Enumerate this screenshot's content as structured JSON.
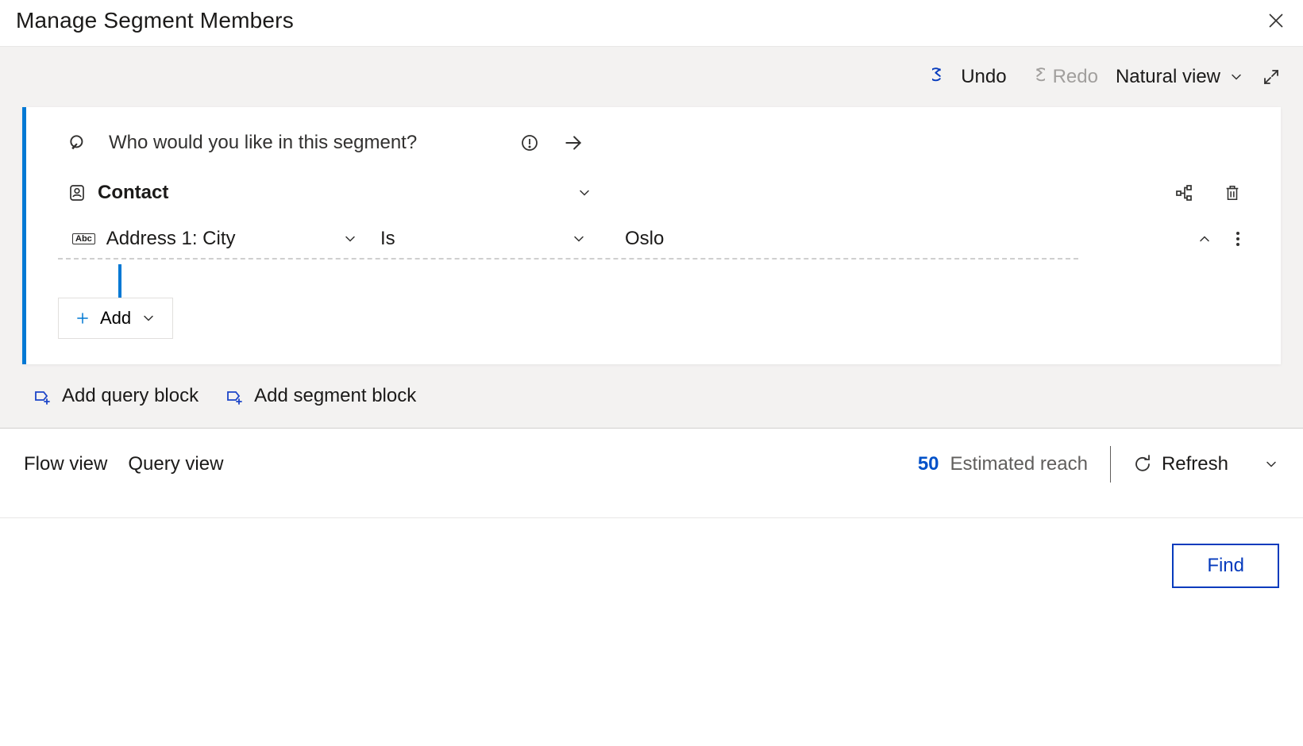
{
  "dialog": {
    "title": "Manage Segment Members"
  },
  "toolbar": {
    "undo": "Undo",
    "redo": "Redo",
    "view_mode": "Natural view"
  },
  "search": {
    "placeholder": "Who would you like in this segment?"
  },
  "entity": {
    "label": "Contact"
  },
  "condition": {
    "field": "Address 1: City",
    "operator": "Is",
    "value": "Oslo"
  },
  "add_button": {
    "label": "Add"
  },
  "adders": {
    "query_block": "Add query block",
    "segment_block": "Add segment block"
  },
  "footer": {
    "flow_view": "Flow view",
    "query_view": "Query view",
    "reach_count": "50",
    "reach_label": "Estimated reach",
    "refresh": "Refresh"
  },
  "actions": {
    "find": "Find"
  }
}
